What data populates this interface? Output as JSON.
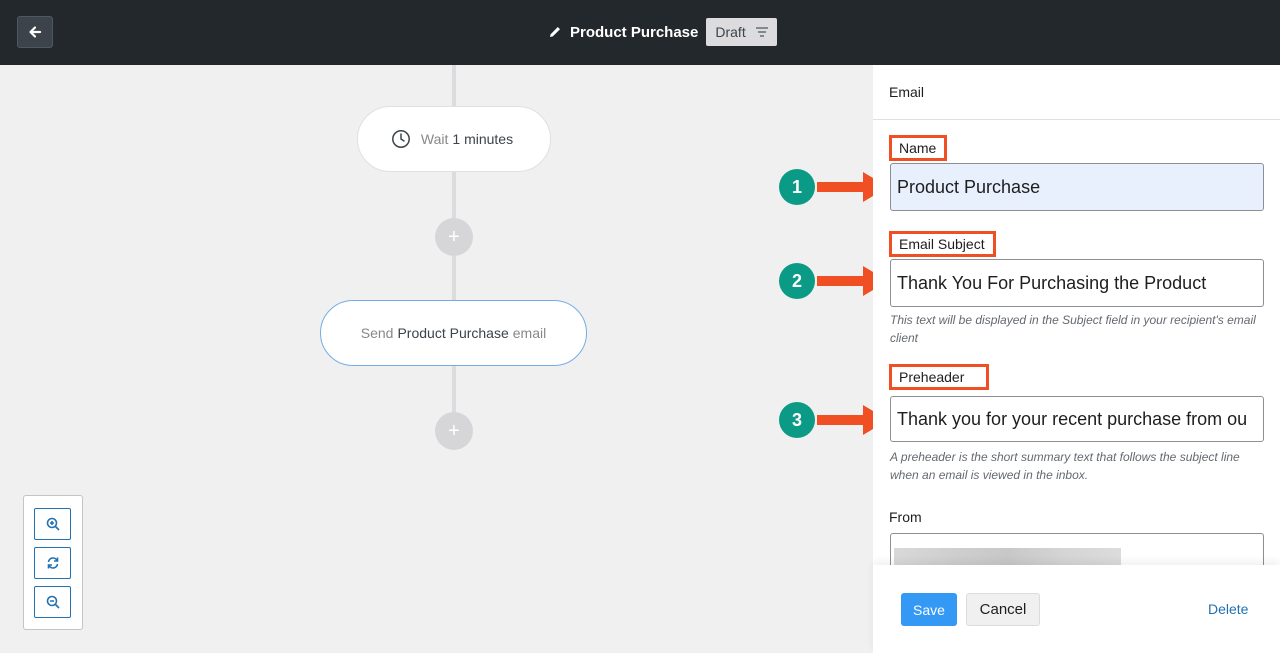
{
  "topbar": {
    "title": "Product Purchase",
    "status_label": "Draft",
    "icons": {
      "back": "arrow-left-icon",
      "edit": "pencil-icon",
      "filter": "filter-lines-icon"
    }
  },
  "canvas": {
    "wait_node": {
      "prefix": "Wait",
      "value": "1 minutes",
      "icon": "clock-icon"
    },
    "send_node": {
      "prefix": "Send",
      "value": "Product Purchase",
      "suffix": "email"
    },
    "add_icon": "+",
    "zoom_controls": [
      "zoom-in-icon",
      "refresh-icon",
      "zoom-out-icon"
    ]
  },
  "annotations": [
    "1",
    "2",
    "3"
  ],
  "panel": {
    "header": "Email",
    "fields": {
      "name": {
        "label": "Name",
        "value": "Product Purchase"
      },
      "subject": {
        "label": "Email Subject",
        "value": "Thank You For Purchasing the Product",
        "help": "This text will be displayed in the Subject field in your recipient's email client"
      },
      "preheader": {
        "label": "Preheader",
        "value": "Thank you for your recent purchase from ou",
        "help": "A preheader is the short summary text that follows the subject line when an email is viewed in the inbox."
      },
      "from": {
        "label": "From"
      }
    },
    "footer": {
      "save": "Save",
      "cancel": "Cancel",
      "delete": "Delete"
    }
  },
  "colors": {
    "accent": "#3499f4",
    "annotation_red": "#f04e23",
    "annotation_teal": "#0a9a85",
    "topbar": "#23282d"
  }
}
